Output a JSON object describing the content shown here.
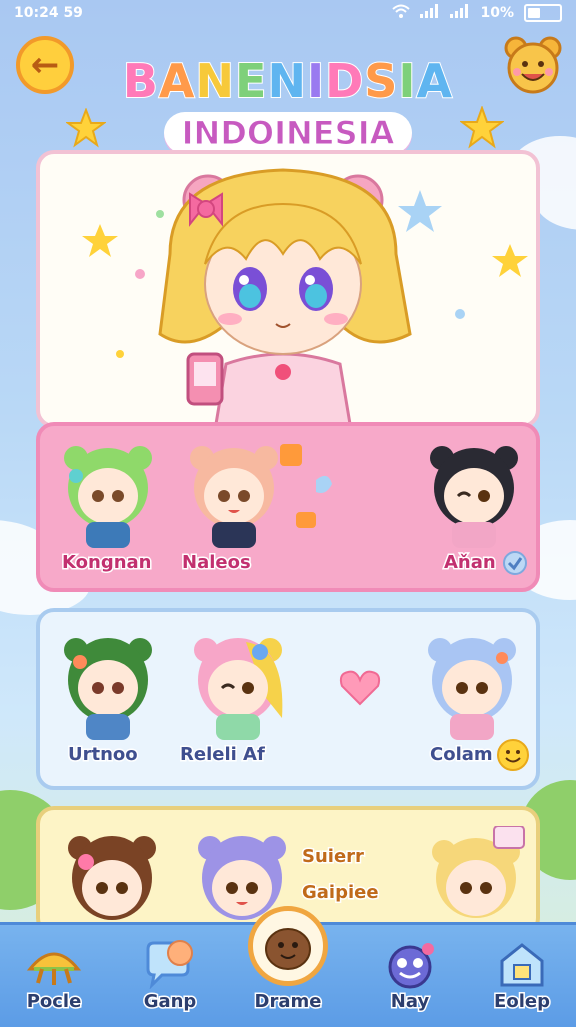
{
  "status": {
    "time": "10:24 59",
    "battery": "10%"
  },
  "header": {
    "title_main": "BANENIDSIA",
    "title_sub": "INDOINESIA",
    "title_colors": [
      "#ff7ab8",
      "#ff9a4a",
      "#f7c93a",
      "#7ed07a",
      "#5fb5f0",
      "#9a7af0",
      "#ff7ab8",
      "#ff9a4a",
      "#7ed07a",
      "#5fb5f0"
    ]
  },
  "rows": {
    "pink": [
      {
        "name": "Kongnan",
        "hair": "#8fd96a"
      },
      {
        "name": "Naleos",
        "hair": "#f7b9a0"
      },
      {
        "name": "Aňan",
        "hair": "#2a2a33"
      }
    ],
    "blue": [
      {
        "name": "Urtnoo",
        "hair": "#3f8a3a"
      },
      {
        "name": "Releli Af",
        "hair": "#f7a6c8"
      },
      {
        "name": "Colam",
        "hair": "#a9c5f3"
      }
    ],
    "yellow": [
      {
        "name": "",
        "hair": "#7a4325"
      },
      {
        "name": "",
        "hair": "#9d93e6"
      },
      {
        "name": "",
        "hair": "#f6d77a"
      }
    ],
    "yellow_labels": [
      "Suierr",
      "Gaipiee"
    ]
  },
  "nav": [
    {
      "label": "Pocle",
      "icon": "taco-icon"
    },
    {
      "label": "Ganp",
      "icon": "chat-bubble-icon"
    },
    {
      "label": "Drame",
      "icon": "chestnut-icon"
    },
    {
      "label": "Nay",
      "icon": "monster-icon"
    },
    {
      "label": "Eolep",
      "icon": "house-icon"
    }
  ]
}
